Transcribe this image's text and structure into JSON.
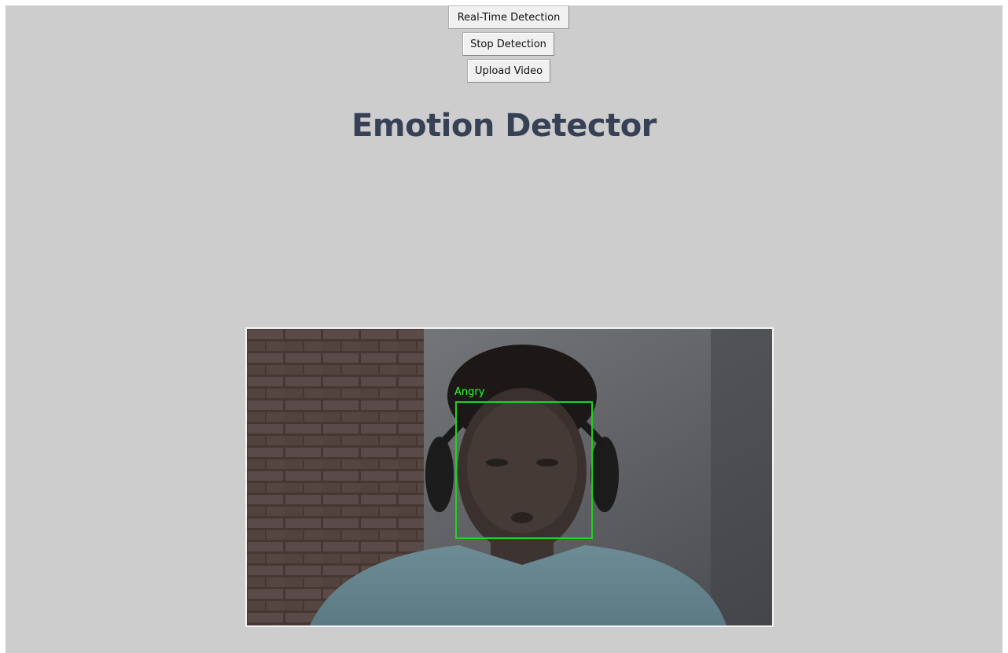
{
  "toolbar": {
    "realtime_label": "Real-Time Detection",
    "stop_label": "Stop Detection",
    "upload_label": "Upload Video"
  },
  "header": {
    "title": "Emotion Detector"
  },
  "video": {
    "detection_label": "Angry"
  },
  "colors": {
    "window_background": "#cdcdcd",
    "title_text": "#364156",
    "detection_box": "#1ed31e"
  }
}
